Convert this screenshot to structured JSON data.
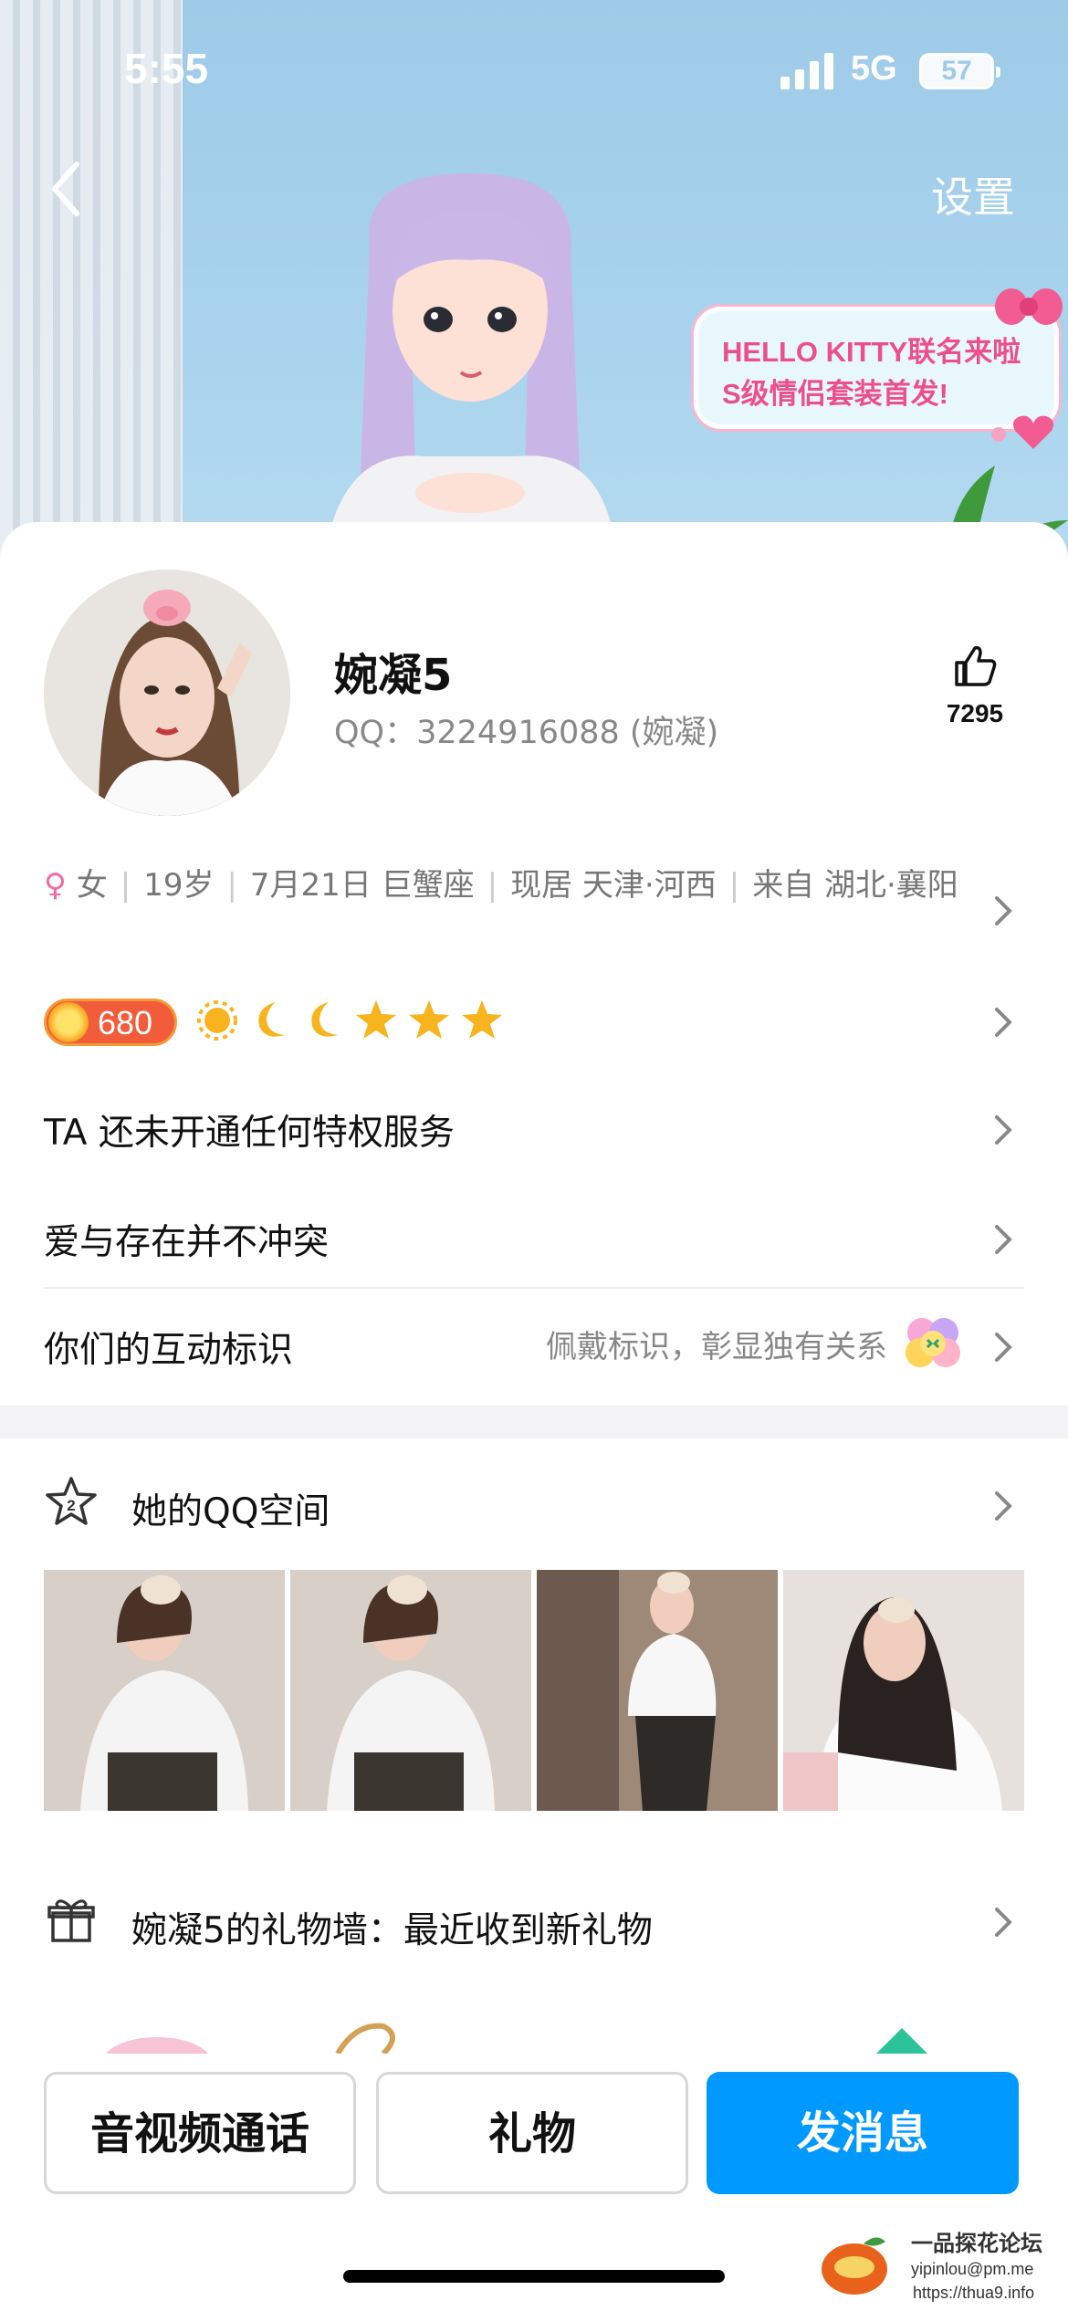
{
  "status_bar": {
    "time": "5:55",
    "network": "5G",
    "battery": "57"
  },
  "header": {
    "settings_label": "设置"
  },
  "banner": {
    "line1": "HELLO KITTY联名来啦",
    "line2": "S级情侣套装首发!"
  },
  "profile": {
    "name": "婉凝5",
    "qq": "QQ：3224916088 (婉凝)",
    "likes": "7295"
  },
  "info": {
    "gender": "女",
    "age": "19岁",
    "birthday": "7月21日 巨蟹座",
    "location": "现居 天津·河西",
    "hometown": "来自 湖北·襄阳"
  },
  "level": {
    "value": "680",
    "icons": [
      "sun-icon",
      "moon-icon",
      "moon-icon",
      "star-icon",
      "star-icon",
      "star-icon"
    ]
  },
  "rows": {
    "privilege": "TA 还未开通任何特权服务",
    "signature": "爱与存在并不冲突",
    "interaction_label": "你们的互动标识",
    "interaction_hint": "佩戴标识，彰显独有关系"
  },
  "qzone": {
    "title": "她的QQ空间",
    "badge": "2"
  },
  "gift_wall": {
    "title": "婉凝5的礼物墙：最近收到新礼物"
  },
  "actions": {
    "call": "音视频通话",
    "gift": "礼物",
    "message": "发消息"
  },
  "watermark": {
    "title": "一品探花论坛",
    "email": "yipinlou@pm.me",
    "url": "https://thua9.info"
  },
  "colors": {
    "accent": "#0099ff",
    "banner_pink": "#ec4f8f",
    "level_orange": "#f25c3a"
  }
}
